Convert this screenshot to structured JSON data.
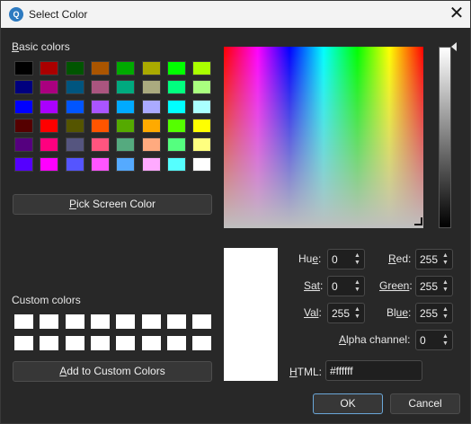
{
  "window": {
    "title": "Select Color",
    "close_glyph": "✕"
  },
  "basic_colors": {
    "label_mnemonic": "B",
    "label_rest": "asic colors",
    "rows": [
      [
        "#000000",
        "#aa0000",
        "#005500",
        "#aa5500",
        "#00aa00",
        "#aaaa00",
        "#00ff00",
        "#aaff00"
      ],
      [
        "#00007f",
        "#aa007f",
        "#00557f",
        "#aa557f",
        "#00aa7f",
        "#aaaa7f",
        "#00ff7f",
        "#aaff7f"
      ],
      [
        "#0000ff",
        "#aa00ff",
        "#0055ff",
        "#aa55ff",
        "#00aaff",
        "#aaaaff",
        "#00ffff",
        "#aaffff"
      ],
      [
        "#550000",
        "#ff0000",
        "#555500",
        "#ff5500",
        "#55aa00",
        "#ffaa00",
        "#55ff00",
        "#ffff00"
      ],
      [
        "#55007f",
        "#ff007f",
        "#55557f",
        "#ff557f",
        "#55aa7f",
        "#ffaa7f",
        "#55ff7f",
        "#ffff7f"
      ],
      [
        "#5500ff",
        "#ff00ff",
        "#5555ff",
        "#ff55ff",
        "#55aaff",
        "#ffaaff",
        "#55ffff",
        "#ffffff"
      ]
    ]
  },
  "pick_screen_color": {
    "mnemonic": "P",
    "rest": "ick Screen Color"
  },
  "custom_colors": {
    "label": "Custom colors",
    "rows": [
      [
        "#ffffff",
        "#ffffff",
        "#ffffff",
        "#ffffff",
        "#ffffff",
        "#ffffff",
        "#ffffff",
        "#ffffff"
      ],
      [
        "#ffffff",
        "#ffffff",
        "#ffffff",
        "#ffffff",
        "#ffffff",
        "#ffffff",
        "#ffffff",
        "#ffffff"
      ]
    ]
  },
  "add_custom": {
    "before": "",
    "mnemonic": "A",
    "rest": "dd to Custom Colors"
  },
  "fields": {
    "hue": {
      "mnemonic": "Hu",
      "under": "e",
      "suffix": ":",
      "value": "0"
    },
    "sat": {
      "mnemonic": "Sat",
      "under": "",
      "suffix": ":",
      "value": "0"
    },
    "val": {
      "mnemonic": "Val",
      "under": "",
      "suffix": ":",
      "value": "255"
    },
    "red": {
      "mnemonic": "R",
      "under": "ed",
      "suffix": ":",
      "value": "255"
    },
    "green": {
      "mnemonic": "Green",
      "under": "",
      "suffix": ":",
      "value": "255"
    },
    "blue": {
      "mnemonic": "Bl",
      "under": "ue",
      "suffix": ":",
      "value": "255"
    },
    "alpha": {
      "mnemonic": "A",
      "under": "lpha channel",
      "suffix": ":",
      "value": "0"
    }
  },
  "html": {
    "label_mnemonic": "H",
    "label_rest": "TML:",
    "value": "#ffffff"
  },
  "buttons": {
    "ok": "OK",
    "cancel": "Cancel"
  },
  "current_color": "#ffffff",
  "icons": {
    "app": "qt-icon",
    "spin_up": "▲",
    "spin_down": "▼"
  }
}
